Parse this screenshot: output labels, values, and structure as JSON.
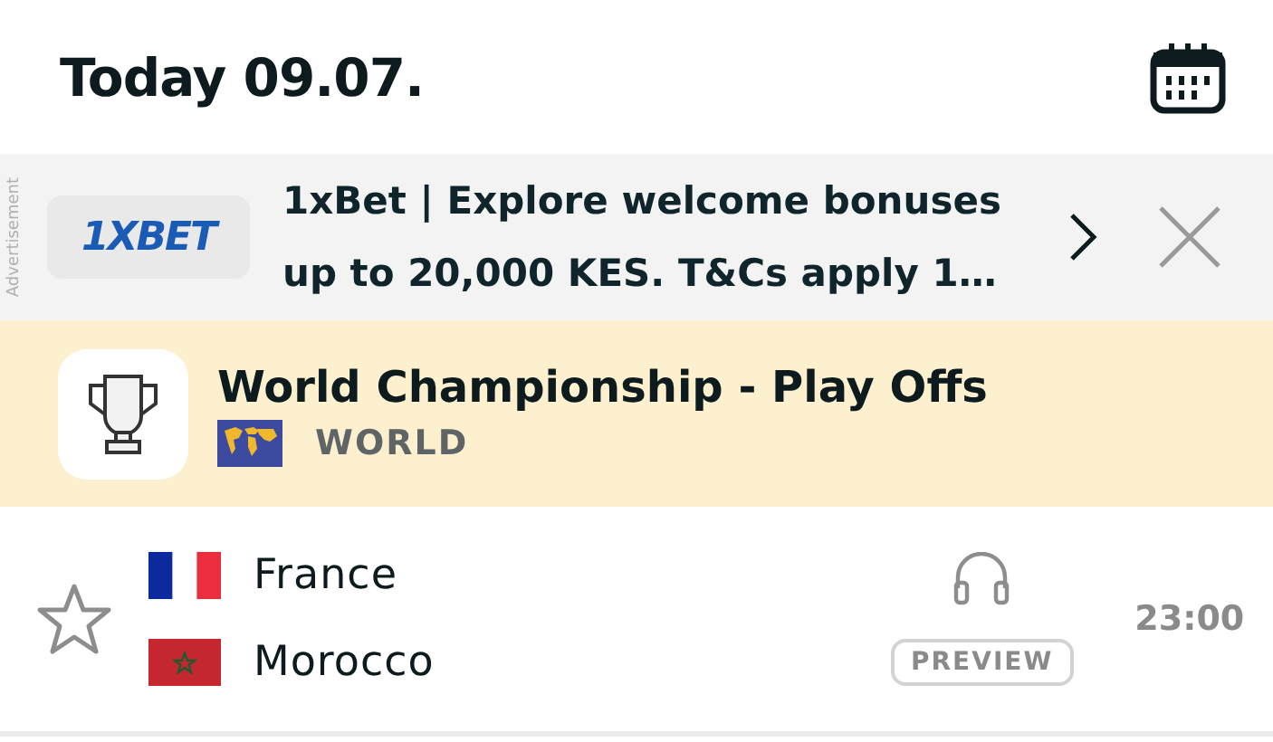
{
  "header": {
    "title": "Today 09.07."
  },
  "ad": {
    "side_label": "Advertisement",
    "logo": "1XBET",
    "text": "1xBet | Explore welcome bonuses up to 20,000 KES. T&Cs apply 1…"
  },
  "league": {
    "name": "World Championship - Play Offs",
    "country": "WORLD"
  },
  "matches": [
    {
      "favorite": false,
      "teams": [
        {
          "name": "France",
          "kind": "fr"
        },
        {
          "name": "Morocco",
          "kind": "ma"
        }
      ],
      "badge": "PREVIEW",
      "time": "23:00"
    }
  ]
}
